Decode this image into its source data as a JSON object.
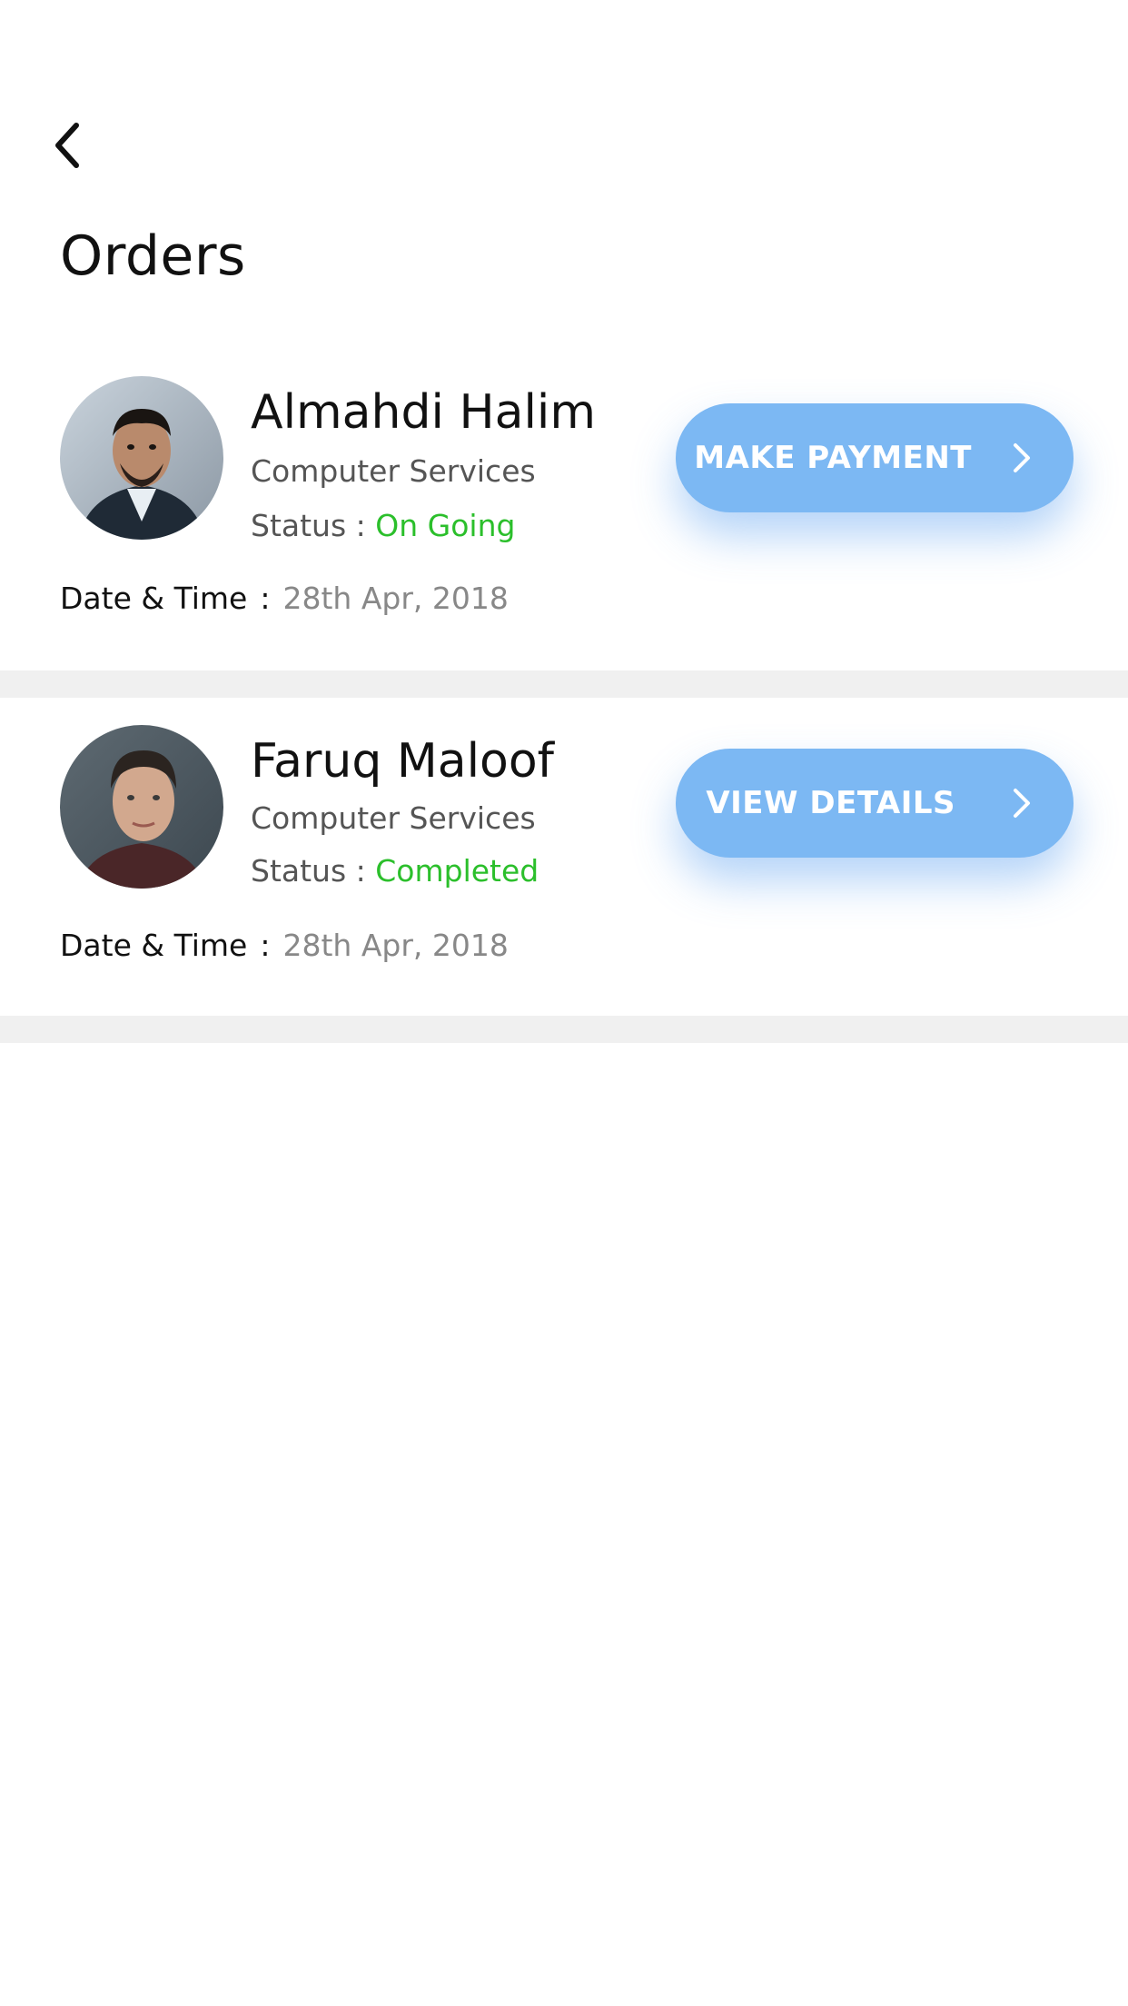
{
  "header": {
    "back_icon": "chevron-left-icon",
    "title": "Orders"
  },
  "orders": [
    {
      "name": "Almahdi Halim",
      "service": "Computer Services",
      "status_label": "Status :",
      "status_value": "On Going",
      "status_color": "#2bbf2b",
      "datetime_label": "Date & Time",
      "datetime_sep": ":",
      "datetime_value": "28th Apr, 2018",
      "action_label": "MAKE PAYMENT",
      "action_icon": "chevron-right-icon"
    },
    {
      "name": "Faruq Maloof",
      "service": "Computer Services",
      "status_label": "Status :",
      "status_value": "Completed",
      "status_color": "#2bbf2b",
      "datetime_label": "Date & Time",
      "datetime_sep": ":",
      "datetime_value": "28th Apr, 2018",
      "action_label": "VIEW DETAILS",
      "action_icon": "chevron-right-icon"
    }
  ],
  "colors": {
    "button": "#7cb8f3",
    "divider": "#f0f0f0",
    "status_green": "#2bbf2b"
  }
}
